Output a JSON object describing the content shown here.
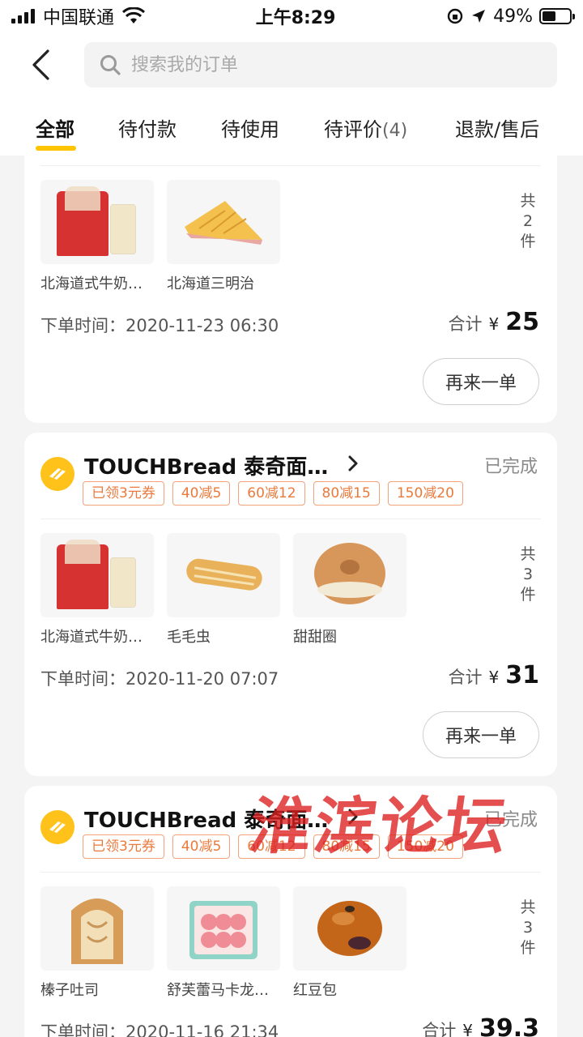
{
  "status_bar": {
    "carrier": "中国联通",
    "time": "上午8:29",
    "battery": "49%",
    "battery_level": 0.49
  },
  "header": {
    "search": {
      "placeholder": "搜索我的订单"
    },
    "tabs": [
      {
        "label": "全部"
      },
      {
        "label": "待付款"
      },
      {
        "label": "待使用"
      },
      {
        "label": "待评价",
        "count": "(4)"
      },
      {
        "label": "退款/售后"
      }
    ]
  },
  "orders": [
    {
      "items": [
        {
          "name": "北海道式牛奶…",
          "image": "milk-bread-set"
        },
        {
          "name": "北海道三明治",
          "image": "sandwich"
        }
      ],
      "qty": [
        "共",
        "2",
        "件"
      ],
      "time_label": "下单时间：",
      "time": "2020-11-23 06:30",
      "total_label": "合计",
      "currency": "¥",
      "total": "25",
      "reorder": "再来一单"
    },
    {
      "store": "TOUCHBread 泰奇面…",
      "status": "已完成",
      "coupons": [
        "已领3元券",
        "40减5",
        "60减12",
        "80减15",
        "150减20"
      ],
      "items": [
        {
          "name": "北海道式牛奶…",
          "image": "milk-bread-set"
        },
        {
          "name": "毛毛虫",
          "image": "caterpillar-bread"
        },
        {
          "name": "甜甜圈",
          "image": "donut"
        }
      ],
      "qty": [
        "共",
        "3",
        "件"
      ],
      "time_label": "下单时间：",
      "time": "2020-11-20 07:07",
      "total_label": "合计",
      "currency": "¥",
      "total": "31",
      "reorder": "再来一单"
    },
    {
      "store": "TOUCHBread 泰奇面…",
      "status": "已完成",
      "coupons": [
        "已领3元券",
        "40减5",
        "60减12",
        "80减15",
        "150减20"
      ],
      "items": [
        {
          "name": "榛子吐司",
          "image": "hazelnut-toast"
        },
        {
          "name": "舒芙蕾马卡龙…",
          "image": "macaron-box"
        },
        {
          "name": "红豆包",
          "image": "red-bean-bun"
        }
      ],
      "qty": [
        "共",
        "3",
        "件"
      ],
      "time_label": "下单时间：",
      "time": "2020-11-16 21:34",
      "total_label": "合计",
      "currency": "¥",
      "total": "39.3"
    }
  ],
  "watermark": "淮滨论坛",
  "colors": {
    "accent": "#ffc400",
    "coupon": "#ea7a3c",
    "watermark": "#dc1e1e"
  }
}
